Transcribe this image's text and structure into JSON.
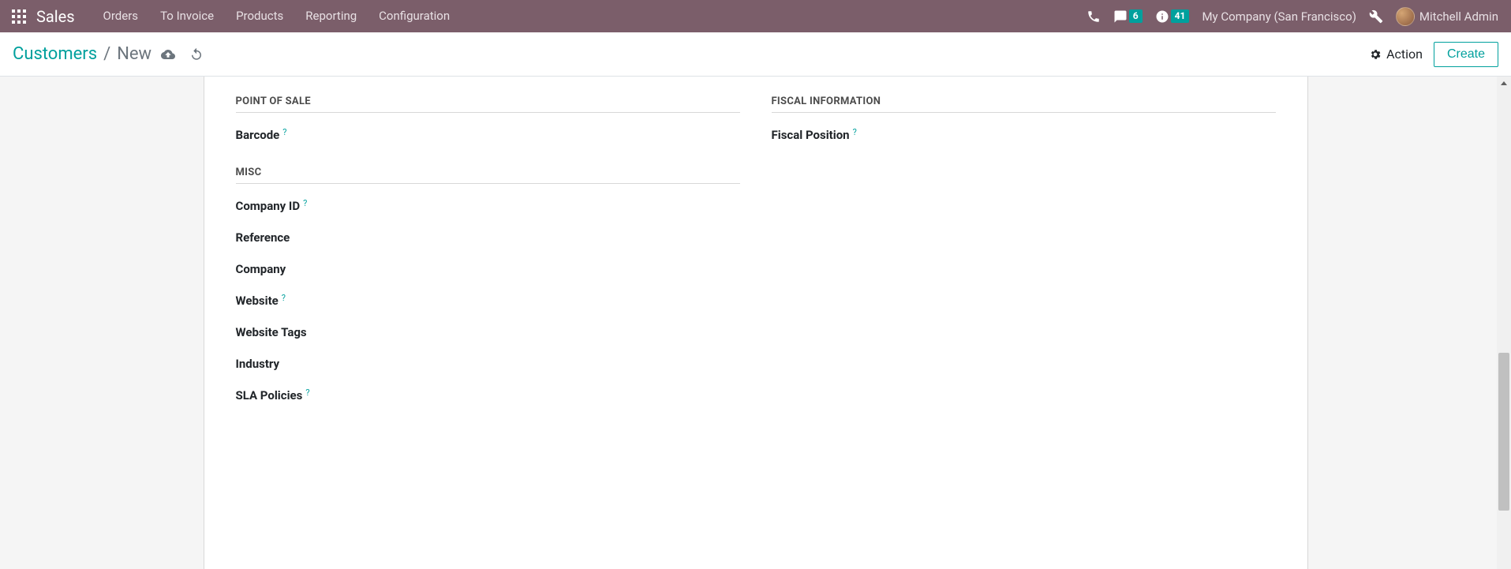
{
  "navbar": {
    "brand": "Sales",
    "menu": [
      "Orders",
      "To Invoice",
      "Products",
      "Reporting",
      "Configuration"
    ],
    "messages_badge": "6",
    "activities_badge": "41",
    "company": "My Company (San Francisco)",
    "user": "Mitchell Admin"
  },
  "control": {
    "breadcrumb_root": "Customers",
    "breadcrumb_current": "New",
    "action_label": "Action",
    "create_label": "Create"
  },
  "form": {
    "left": {
      "section_pos": "POINT OF SALE",
      "barcode_label": "Barcode",
      "section_misc": "MISC",
      "company_id_label": "Company ID",
      "reference_label": "Reference",
      "company_label": "Company",
      "website_label": "Website",
      "website_tags_label": "Website Tags",
      "industry_label": "Industry",
      "sla_label": "SLA Policies"
    },
    "right": {
      "section_fiscal": "FISCAL INFORMATION",
      "fiscal_position_label": "Fiscal Position"
    },
    "help_q": "?"
  }
}
